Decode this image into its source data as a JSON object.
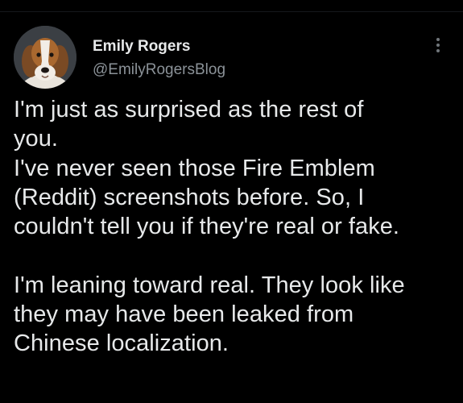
{
  "author": {
    "display_name": "Emily Rogers",
    "handle": "@EmilyRogersBlog",
    "avatar_icon": "beagle-dog-avatar"
  },
  "menu": {
    "icon": "more-options-vertical-icon"
  },
  "tweet": {
    "lines": [
      "I'm just as surprised as the rest of",
      "you.",
      "I've never seen those Fire Emblem",
      "(Reddit) screenshots before.  So, I",
      "couldn't tell you if they're real or fake.",
      "",
      "I'm leaning toward real. They look like",
      "they may have been leaked from",
      "Chinese localization."
    ]
  },
  "colors": {
    "background": "#000000",
    "text_primary": "#e7e9ea",
    "text_secondary": "#8b9298"
  }
}
